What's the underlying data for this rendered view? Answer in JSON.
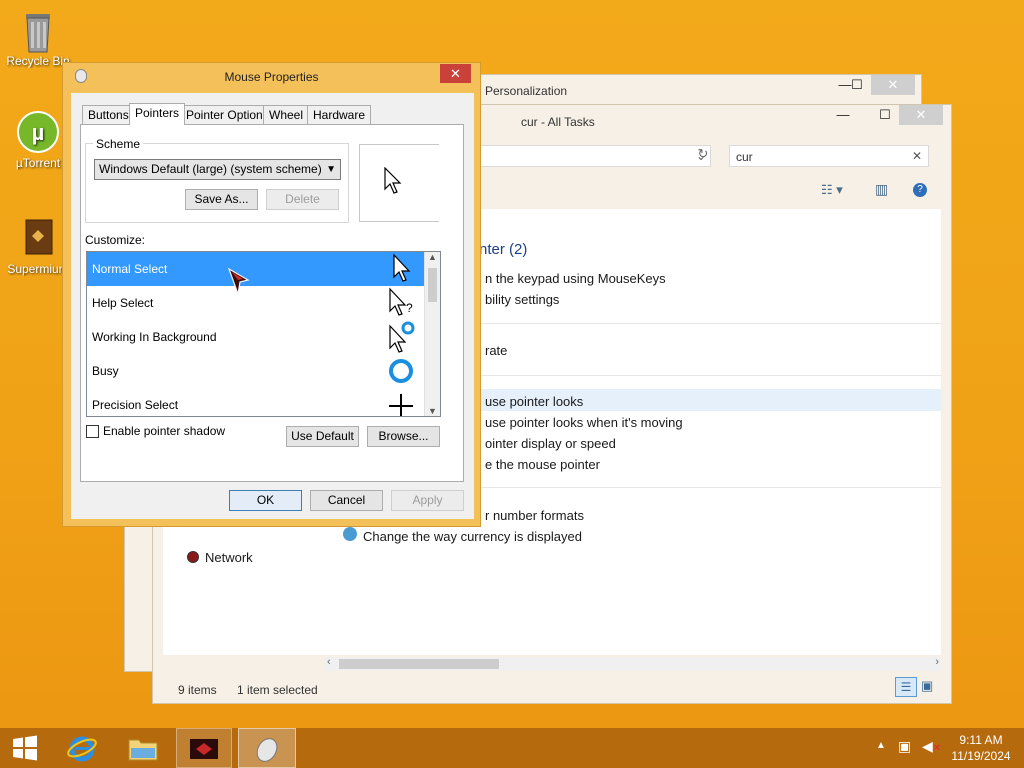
{
  "desktop": {
    "icons": [
      {
        "label": "Recycle Bin",
        "icon": "recycle-bin-icon"
      },
      {
        "label": "µTorrent",
        "icon": "utorrent-icon"
      },
      {
        "label": "Supermium",
        "icon": "supermium-icon"
      }
    ]
  },
  "personalization_window": {
    "title": "Personalization"
  },
  "explorer": {
    "title": "cur - All Tasks",
    "search_value": "cur",
    "content": {
      "group_heading": "nter (2)",
      "lines": [
        "n the keypad using MouseKeys",
        "bility settings",
        "rate",
        "use pointer looks",
        "use pointer looks when it's moving",
        "ointer display or speed",
        "e the mouse pointer",
        "r number formats",
        "Change the way currency is displayed"
      ],
      "network": "Network"
    },
    "status": {
      "items": "9 items",
      "selected": "1 item selected"
    }
  },
  "mouse_properties": {
    "title": "Mouse Properties",
    "tabs": [
      "Buttons",
      "Pointers",
      "Pointer Options",
      "Wheel",
      "Hardware"
    ],
    "active_tab": "Pointers",
    "scheme": {
      "label": "Scheme",
      "value": "Windows Default (large) (system scheme)",
      "save_as": "Save As...",
      "delete": "Delete"
    },
    "customize_label": "Customize:",
    "pointers": [
      {
        "name": "Normal Select",
        "icon": "arrow-cursor-icon",
        "selected": true
      },
      {
        "name": "Help Select",
        "icon": "help-cursor-icon",
        "selected": false
      },
      {
        "name": "Working In Background",
        "icon": "working-cursor-icon",
        "selected": false
      },
      {
        "name": "Busy",
        "icon": "busy-cursor-icon",
        "selected": false
      },
      {
        "name": "Precision Select",
        "icon": "crosshair-cursor-icon",
        "selected": false
      }
    ],
    "enable_shadow": "Enable pointer shadow",
    "use_default": "Use Default",
    "browse": "Browse...",
    "ok": "OK",
    "cancel": "Cancel",
    "apply": "Apply"
  },
  "taskbar": {
    "time": "9:11 AM",
    "date": "11/19/2024"
  },
  "colors": {
    "desktop": "#f2a91a",
    "dialog_frame": "#f4c05a",
    "selection": "#3399ff",
    "taskbar": "#b56a0e"
  }
}
